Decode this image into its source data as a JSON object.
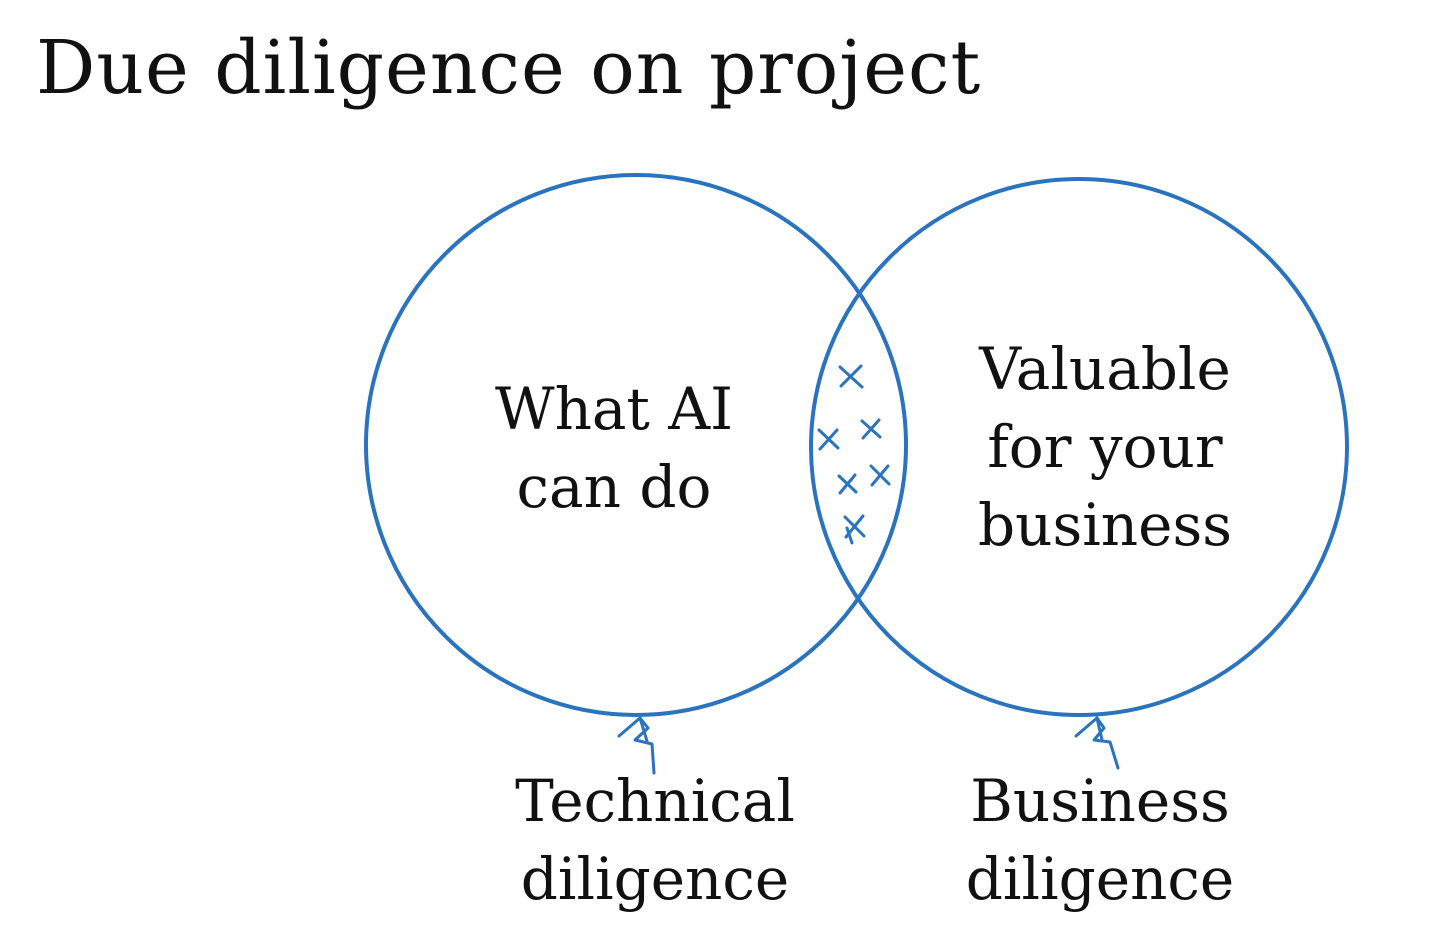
{
  "title": "Due diligence on project",
  "colors": {
    "accent": "#2a73bf",
    "text": "#111111",
    "background": "#ffffff"
  },
  "venn": {
    "left_circle": {
      "lines": [
        "What AI",
        "can do"
      ]
    },
    "right_circle": {
      "lines": [
        "Valuable",
        "for your",
        "business"
      ]
    },
    "overlap_marks": {
      "symbol": "x",
      "count": 7
    }
  },
  "captions": {
    "technical": {
      "lines": [
        "Technical",
        "diligence"
      ]
    },
    "business": {
      "lines": [
        "Business",
        "diligence"
      ]
    }
  }
}
